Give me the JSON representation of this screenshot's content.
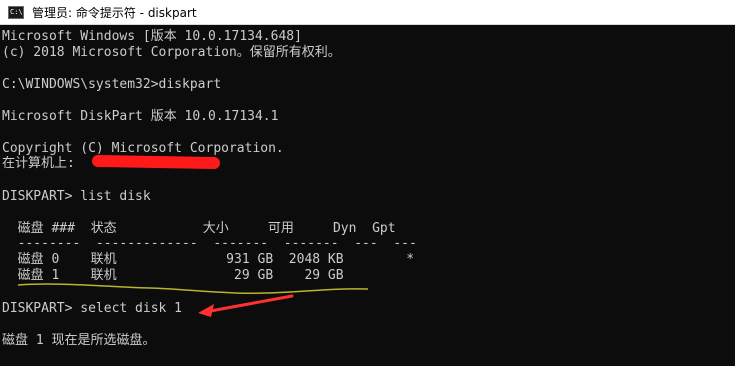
{
  "window": {
    "title": "管理员: 命令提示符 - diskpart",
    "icon": "command-prompt-icon"
  },
  "console": {
    "lines": [
      "Microsoft Windows [版本 10.0.17134.648]",
      "(c) 2018 Microsoft Corporation。保留所有权利。",
      "C:\\WINDOWS\\system32>diskpart",
      "Microsoft DiskPart 版本 10.0.17134.1",
      "Copyright (C) Microsoft Corporation.",
      "在计算机上:",
      "DISKPART> list disk",
      "  磁盘 ###  状态           大小     可用     Dyn  Gpt",
      "  --------  -------------  -------  -------  ---  ---",
      "  磁盘 0    联机              931 GB  2048 KB        *",
      "  磁盘 1    联机               29 GB    29 GB",
      "DISKPART> select disk 1",
      "磁盘 1 现在是所选磁盘。"
    ]
  },
  "colors": {
    "console_bg": "#0c0c0c",
    "console_text": "#cccccc",
    "annotation_arrow": "#ff3030",
    "annotation_underline": "#b6b62a",
    "redaction": "#ff1a1a"
  }
}
